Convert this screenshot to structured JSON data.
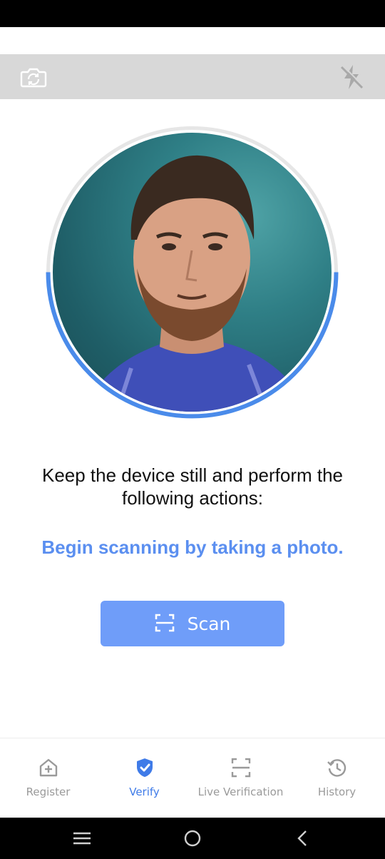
{
  "toolbar": {
    "switch_camera_icon": "camera-switch-icon",
    "flash_icon": "flash-off-icon"
  },
  "main": {
    "instruction": "Keep the device still and perform the following actions:",
    "status_message": "Begin scanning by taking a photo.",
    "scan_button_label": "Scan",
    "scan_progress": 0.5
  },
  "bottom_nav": {
    "items": [
      {
        "label": "Register",
        "icon": "home-add-icon",
        "active": false
      },
      {
        "label": "Verify",
        "icon": "shield-check-icon",
        "active": true
      },
      {
        "label": "Live Verification",
        "icon": "scan-frame-icon",
        "active": false
      },
      {
        "label": "History",
        "icon": "history-icon",
        "active": false
      }
    ]
  },
  "colors": {
    "accent": "#3f7be8",
    "scan_button": "#6f9df9",
    "status_text": "#5b8ff0",
    "toolbar_bg": "#d8d8d8",
    "inactive": "#9a9a9a"
  }
}
